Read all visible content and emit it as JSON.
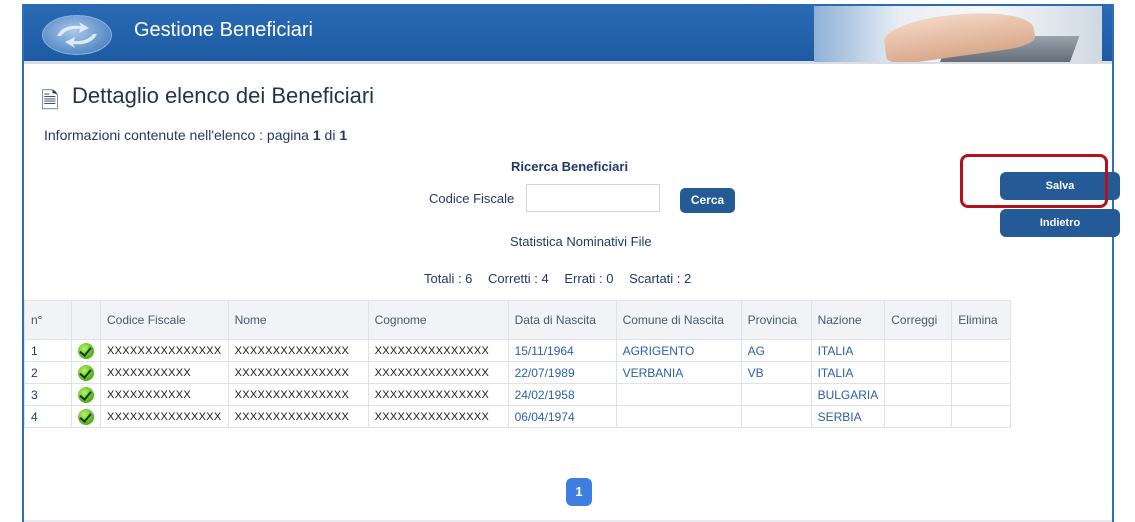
{
  "header": {
    "title": "Gestione Beneficiari"
  },
  "page": {
    "title": "Dettaglio elenco dei Beneficiari",
    "info_prefix": "Informazioni contenute nell'elenco  :  pagina ",
    "page_current": "1",
    "page_sep": " di ",
    "page_total": "1"
  },
  "search": {
    "title": "Ricerca Beneficiari",
    "cf_label": "Codice Fiscale",
    "cf_value": "",
    "button": "Cerca"
  },
  "stats": {
    "title": "Statistica Nominativi File",
    "totali": "Totali : 6",
    "corretti": "Corretti : 4",
    "errati": "Errati :  0",
    "scartati": "Scartati :  2"
  },
  "actions": {
    "salva": "Salva",
    "indietro": "Indietro"
  },
  "table": {
    "headers": [
      "n°",
      "",
      "Codice Fiscale",
      "Nome",
      "Cognome",
      "Data di Nascita",
      "Comune di Nascita",
      "Provincia",
      "Nazione",
      "Correggi",
      "Elimina"
    ],
    "rows": [
      {
        "n": "1",
        "cf": "XXXXXXXXXXXXXXX",
        "nome": "XXXXXXXXXXXXXXX",
        "cognome": "XXXXXXXXXXXXXXX",
        "data": "15/11/1964",
        "comune": "AGRIGENTO",
        "provincia": "AG",
        "nazione": "ITALIA"
      },
      {
        "n": "2",
        "cf": "XXXXXXXXXXX",
        "nome": "XXXXXXXXXXXXXXX",
        "cognome": "XXXXXXXXXXXXXXX",
        "data": "22/07/1989",
        "comune": "VERBANIA",
        "provincia": "VB",
        "nazione": "ITALIA"
      },
      {
        "n": "3",
        "cf": "XXXXXXXXXXX",
        "nome": "XXXXXXXXXXXXXXX",
        "cognome": "XXXXXXXXXXXXXXX",
        "data": "24/02/1958",
        "comune": "",
        "provincia": "",
        "nazione": "BULGARIA"
      },
      {
        "n": "4",
        "cf": "XXXXXXXXXXXXXXX",
        "nome": "XXXXXXXXXXXXXXX",
        "cognome": "XXXXXXXXXXXXXXX",
        "data": "06/04/1974",
        "comune": "",
        "provincia": "",
        "nazione": "SERBIA"
      }
    ]
  },
  "pager": {
    "current": "1"
  },
  "colors": {
    "brand": "#2a6bb6",
    "button": "#245a96",
    "highlight": "#b1121c",
    "pager": "#3d7ee0"
  }
}
